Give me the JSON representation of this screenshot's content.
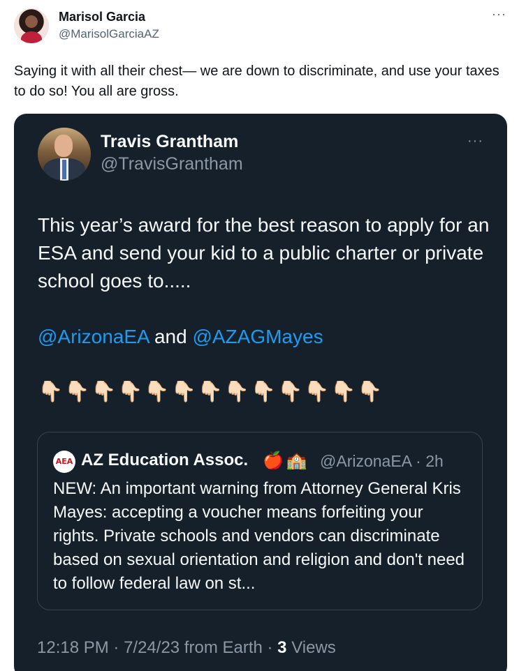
{
  "outer_tweet": {
    "author_name": "Marisol Garcia",
    "author_handle": "@MarisolGarciaAZ",
    "more": "···",
    "text": "Saying it with all their chest— we are down to discriminate, and use your taxes to do so!  You all are gross."
  },
  "embedded_tweet": {
    "author_name": "Travis Grantham",
    "author_handle": "@TravisGrantham",
    "more": "···",
    "text": "This year’s award for the best reason to apply for an ESA and send your kid to a public charter or private school goes to.....",
    "mention_1": "@ArizonaEA",
    "mention_joiner": " and ",
    "mention_2": "@AZAGMayes",
    "emoji_row": "👇🏻👇🏻👇🏻👇🏻👇🏻👇🏻👇🏻👇🏻👇🏻👇🏻👇🏻👇🏻👇🏻",
    "time": "12:18 PM",
    "separator_1": " · ",
    "date": "7/24/23",
    "source": " from Earth",
    "separator_2": " · ",
    "views_count": "3",
    "views_label": " Views"
  },
  "quoted_tweet": {
    "logo_text": "AEA",
    "author_name": "AZ Education Assoc.",
    "emoji_apple": "🍎",
    "emoji_school": "🏫",
    "author_handle": "@ArizonaEA",
    "time_ago": " · 2h",
    "text": "NEW: An important warning from Attorney General Kris Mayes: accepting a voucher means forfeiting your rights. Private schools and vendors can discriminate based on sexual orientation and religion and don't need to follow federal law on st..."
  }
}
